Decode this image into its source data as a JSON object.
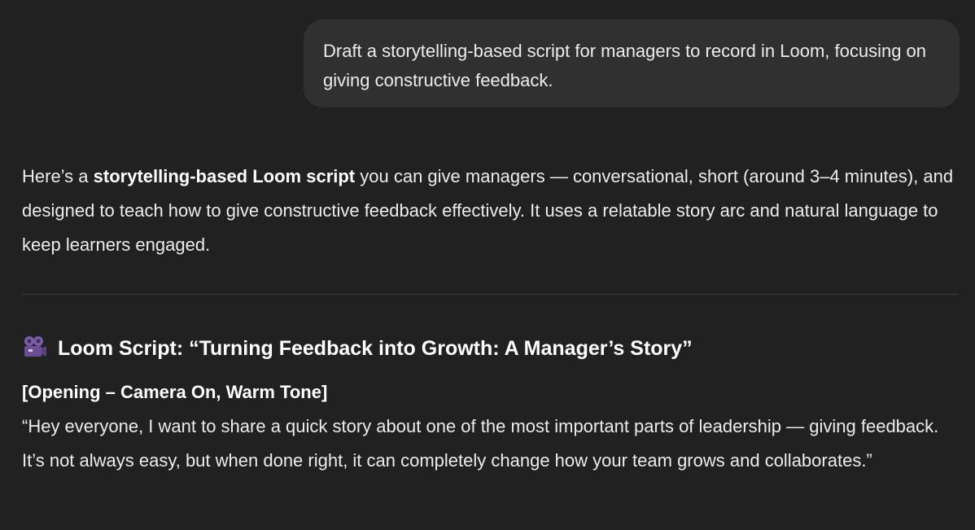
{
  "user_message": {
    "text": "Draft a storytelling-based script for managers to record in Loom, focusing on giving constructive feedback."
  },
  "assistant_message": {
    "intro": {
      "prefix": "Here’s a ",
      "bold": "storytelling-based Loom script",
      "suffix": " you can give managers — conversational, short (around 3–4 minutes), and designed to teach how to give constructive feedback effectively. It uses a relatable story arc and natural language to keep learners engaged."
    },
    "script_title": {
      "icon": "movie-camera-icon",
      "text": "Loom Script: “Turning Feedback into Growth: A Manager’s Story”"
    },
    "section_heading": "[Opening – Camera On, Warm Tone]",
    "quote": "“Hey everyone, I want to share a quick story about one of the most important parts of leadership — giving feedback. It’s not always easy, but when done right, it can completely change how your team grows and collaborates.”"
  },
  "colors": {
    "background": "#212121",
    "user_bubble": "#303030",
    "text": "#ececec",
    "heading": "#ffffff",
    "divider": "#3a3a3a",
    "icon_accent": "#7b5ea7"
  }
}
